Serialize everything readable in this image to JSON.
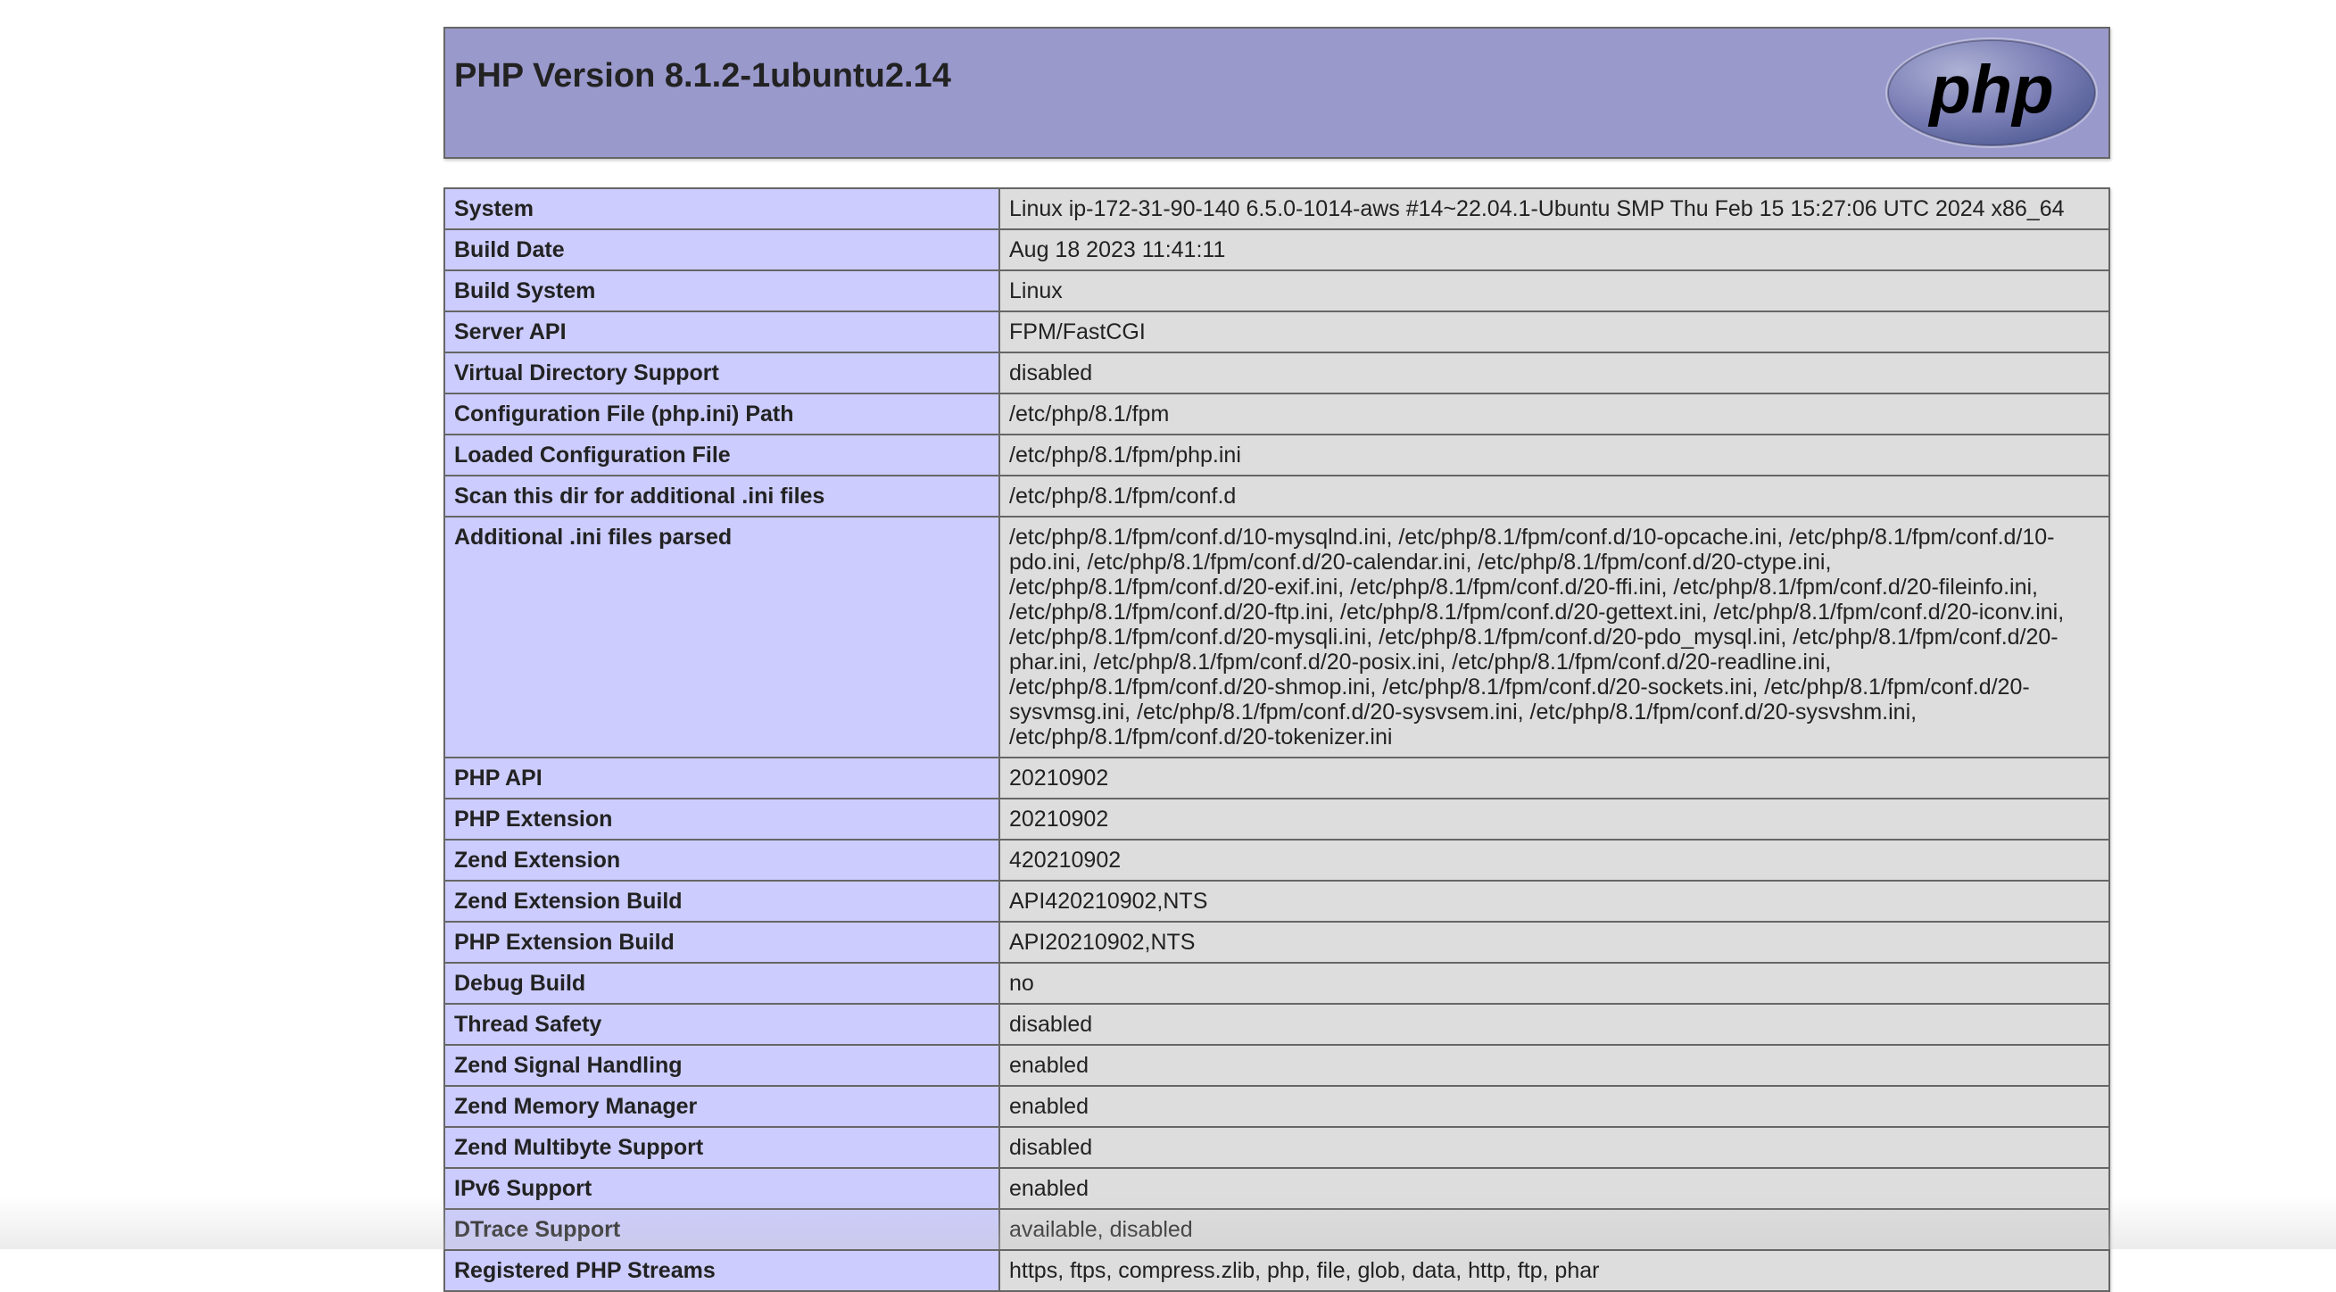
{
  "header": {
    "title": "PHP Version 8.1.2-1ubuntu2.14",
    "logo_text": "php"
  },
  "rows": [
    {
      "label": "System",
      "value": "Linux ip-172-31-90-140 6.5.0-1014-aws #14~22.04.1-Ubuntu SMP Thu Feb 15 15:27:06 UTC 2024 x86_64"
    },
    {
      "label": "Build Date",
      "value": "Aug 18 2023 11:41:11"
    },
    {
      "label": "Build System",
      "value": "Linux"
    },
    {
      "label": "Server API",
      "value": "FPM/FastCGI"
    },
    {
      "label": "Virtual Directory Support",
      "value": "disabled"
    },
    {
      "label": "Configuration File (php.ini) Path",
      "value": "/etc/php/8.1/fpm"
    },
    {
      "label": "Loaded Configuration File",
      "value": "/etc/php/8.1/fpm/php.ini"
    },
    {
      "label": "Scan this dir for additional .ini files",
      "value": "/etc/php/8.1/fpm/conf.d"
    },
    {
      "label": "Additional .ini files parsed",
      "value": "/etc/php/8.1/fpm/conf.d/10-mysqlnd.ini, /etc/php/8.1/fpm/conf.d/10-opcache.ini, /etc/php/8.1/fpm/conf.d/10-pdo.ini, /etc/php/8.1/fpm/conf.d/20-calendar.ini, /etc/php/8.1/fpm/conf.d/20-ctype.ini, /etc/php/8.1/fpm/conf.d/20-exif.ini, /etc/php/8.1/fpm/conf.d/20-ffi.ini, /etc/php/8.1/fpm/conf.d/20-fileinfo.ini, /etc/php/8.1/fpm/conf.d/20-ftp.ini, /etc/php/8.1/fpm/conf.d/20-gettext.ini, /etc/php/8.1/fpm/conf.d/20-iconv.ini, /etc/php/8.1/fpm/conf.d/20-mysqli.ini, /etc/php/8.1/fpm/conf.d/20-pdo_mysql.ini, /etc/php/8.1/fpm/conf.d/20-phar.ini, /etc/php/8.1/fpm/conf.d/20-posix.ini, /etc/php/8.1/fpm/conf.d/20-readline.ini, /etc/php/8.1/fpm/conf.d/20-shmop.ini, /etc/php/8.1/fpm/conf.d/20-sockets.ini, /etc/php/8.1/fpm/conf.d/20-sysvmsg.ini, /etc/php/8.1/fpm/conf.d/20-sysvsem.ini, /etc/php/8.1/fpm/conf.d/20-sysvshm.ini, /etc/php/8.1/fpm/conf.d/20-tokenizer.ini"
    },
    {
      "label": "PHP API",
      "value": "20210902"
    },
    {
      "label": "PHP Extension",
      "value": "20210902"
    },
    {
      "label": "Zend Extension",
      "value": "420210902"
    },
    {
      "label": "Zend Extension Build",
      "value": "API420210902,NTS"
    },
    {
      "label": "PHP Extension Build",
      "value": "API20210902,NTS"
    },
    {
      "label": "Debug Build",
      "value": "no"
    },
    {
      "label": "Thread Safety",
      "value": "disabled"
    },
    {
      "label": "Zend Signal Handling",
      "value": "enabled"
    },
    {
      "label": "Zend Memory Manager",
      "value": "enabled"
    },
    {
      "label": "Zend Multibyte Support",
      "value": "disabled"
    },
    {
      "label": "IPv6 Support",
      "value": "enabled"
    },
    {
      "label": "DTrace Support",
      "value": "available, disabled"
    },
    {
      "label": "Registered PHP Streams",
      "value": "https, ftps, compress.zlib, php, file, glob, data, http, ftp, phar"
    }
  ]
}
